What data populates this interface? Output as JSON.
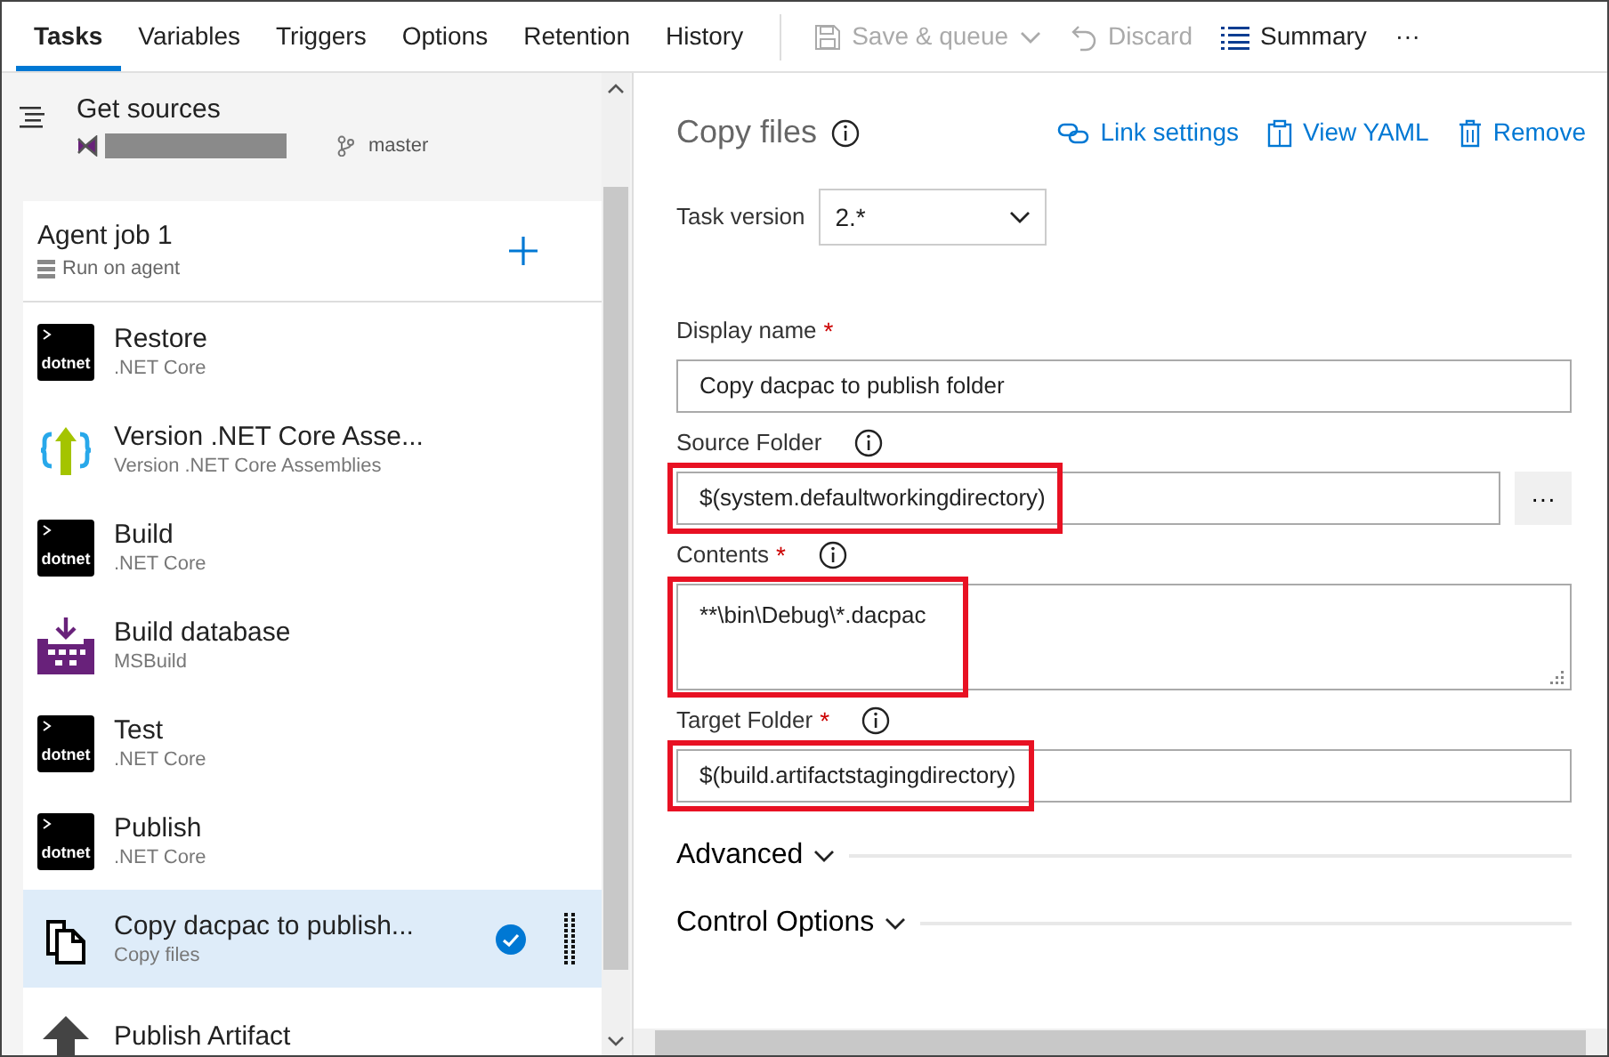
{
  "toolbar": {
    "tabs": [
      {
        "label": "Tasks",
        "selected": true
      },
      {
        "label": "Variables",
        "selected": false
      },
      {
        "label": "Triggers",
        "selected": false
      },
      {
        "label": "Options",
        "selected": false
      },
      {
        "label": "Retention",
        "selected": false
      },
      {
        "label": "History",
        "selected": false
      }
    ],
    "actions": [
      {
        "kind": "save",
        "label": "Save & queue",
        "disabled": true,
        "dropdown": true
      },
      {
        "kind": "discard",
        "label": "Discard",
        "disabled": true,
        "dropdown": false
      },
      {
        "kind": "summary",
        "label": "Summary",
        "disabled": false,
        "dropdown": false
      }
    ],
    "more": "···"
  },
  "sidebar": {
    "sources": {
      "title": "Get sources",
      "branch": "master"
    },
    "job": {
      "title": "Agent job 1",
      "subtitle": "Run on agent"
    },
    "tasks": [
      {
        "kind": "dotnet",
        "icon_label": "dotnet",
        "title": "Restore",
        "subtitle": ".NET Core",
        "selected": false
      },
      {
        "kind": "version",
        "title": "Version .NET Core Asse...",
        "subtitle": "Version .NET Core Assemblies",
        "selected": false
      },
      {
        "kind": "dotnet",
        "icon_label": "dotnet",
        "title": "Build",
        "subtitle": ".NET Core",
        "selected": false
      },
      {
        "kind": "msbuild",
        "title": "Build database",
        "subtitle": "MSBuild",
        "selected": false
      },
      {
        "kind": "dotnet",
        "icon_label": "dotnet",
        "title": "Test",
        "subtitle": ".NET Core",
        "selected": false
      },
      {
        "kind": "dotnet",
        "icon_label": "dotnet",
        "title": "Publish",
        "subtitle": ".NET Core",
        "selected": false
      },
      {
        "kind": "copy",
        "title": "Copy dacpac to publish...",
        "subtitle": "Copy files",
        "selected": true
      },
      {
        "kind": "publish",
        "title": "Publish Artifact",
        "selected": false
      }
    ]
  },
  "panel": {
    "title": "Copy files",
    "links": [
      {
        "kind": "link",
        "label": "Link settings"
      },
      {
        "kind": "yaml",
        "label": "View YAML"
      },
      {
        "kind": "remove",
        "label": "Remove"
      }
    ],
    "task_version": {
      "label": "Task version",
      "value": "2.*"
    },
    "fields": [
      {
        "kind": "input",
        "label": "Display name",
        "required_mark": "*",
        "info": false,
        "value": "Copy dacpac to publish folder",
        "highlighted": false
      },
      {
        "kind": "input",
        "label": "Source Folder",
        "info": true,
        "value": "$(system.defaultworkingdirectory)",
        "highlighted": true,
        "browse": "···"
      },
      {
        "kind": "textarea",
        "label": "Contents",
        "required_mark": "*",
        "info": true,
        "value": "**\\bin\\Debug\\*.dacpac",
        "highlighted": true
      },
      {
        "kind": "input",
        "label": "Target Folder",
        "required_mark": "*",
        "info": true,
        "value": "$(build.artifactstagingdirectory)",
        "highlighted": true
      }
    ],
    "sections": [
      {
        "label": "Advanced",
        "expanded": false
      },
      {
        "label": "Control Options",
        "expanded": false
      }
    ]
  }
}
